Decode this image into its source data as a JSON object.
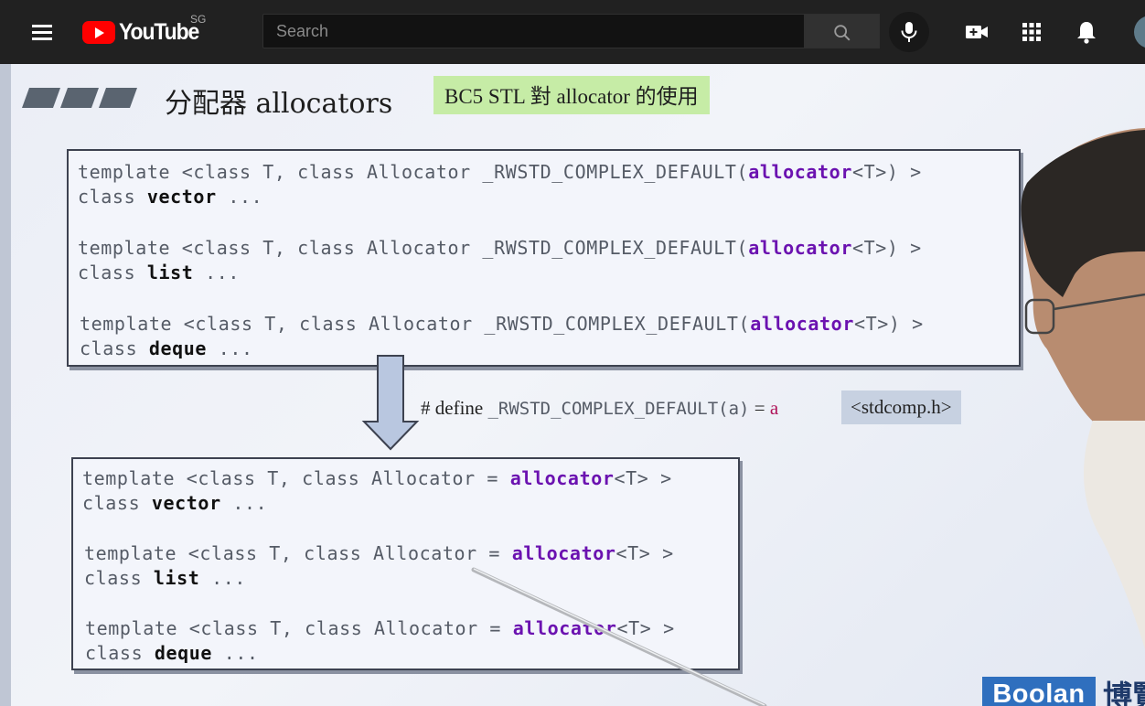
{
  "header": {
    "menu_icon": "hamburger-menu-icon",
    "logo_text": "YouTube",
    "region": "SG",
    "search_placeholder": "Search",
    "search_icon": "search-icon",
    "mic_icon": "microphone-icon",
    "create_icon": "video-camera-plus-icon",
    "apps_icon": "apps-grid-icon",
    "notifications_icon": "bell-icon"
  },
  "slide": {
    "title": "分配器 allocators",
    "subtitle": "BC5 STL 對 allocator 的使用",
    "top_box": [
      {
        "line1_prefix": "template <class T, class Allocator _RWSTD_COMPLEX_DEFAULT(",
        "line1_kw": "allocator",
        "line1_suffix": "<T>) >",
        "line2_prefix": "class ",
        "line2_bold": "vector",
        "line2_suffix": " ..."
      },
      {
        "line1_prefix": "template <class T, class Allocator _RWSTD_COMPLEX_DEFAULT(",
        "line1_kw": "allocator",
        "line1_suffix": "<T>) >",
        "line2_prefix": "class ",
        "line2_bold": "list",
        "line2_suffix": " ..."
      },
      {
        "line1_prefix": "template <class T, class Allocator _RWSTD_COMPLEX_DEFAULT(",
        "line1_kw": "allocator",
        "line1_suffix": "<T>) >",
        "line2_prefix": "class ",
        "line2_bold": "deque",
        "line2_suffix": " ..."
      }
    ],
    "define": {
      "prefix": "# define ",
      "macro": "_RWSTD_COMPLEX_DEFAULT(a)",
      "eq": " = ",
      "value": "a",
      "header_file": "<stdcomp.h>"
    },
    "bottom_box": [
      {
        "line1_prefix": "template <class T, class Allocator = ",
        "line1_kw": "allocator",
        "line1_suffix": "<T> >",
        "line2_prefix": "class ",
        "line2_bold": "vector",
        "line2_suffix": " ..."
      },
      {
        "line1_prefix": "template <class T, class Allocator = ",
        "line1_kw": "allocator",
        "line1_suffix": "<T> >",
        "line2_prefix": "class ",
        "line2_bold": "list",
        "line2_suffix": " ..."
      },
      {
        "line1_prefix": "template <class T, class Allocator = ",
        "line1_kw": "allocator",
        "line1_suffix": "<T> >",
        "line2_prefix": "class ",
        "line2_bold": "deque",
        "line2_suffix": " ..."
      }
    ],
    "brand": "Boolan",
    "brand_cjk": "博覽"
  }
}
